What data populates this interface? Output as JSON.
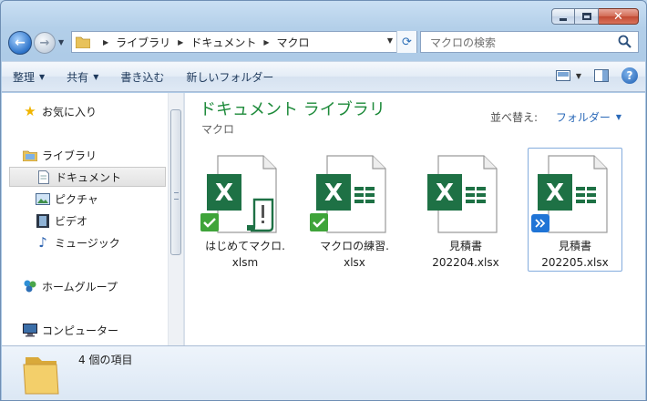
{
  "window": {
    "breadcrumb": [
      "ライブラリ",
      "ドキュメント",
      "マクロ"
    ],
    "search_placeholder": "マクロの検索"
  },
  "toolbar": {
    "organize": "整理",
    "share": "共有",
    "burn": "書き込む",
    "new_folder": "新しいフォルダー"
  },
  "sidebar": {
    "favorites": "お気に入り",
    "libraries": "ライブラリ",
    "documents": "ドキュメント",
    "pictures": "ピクチャ",
    "videos": "ビデオ",
    "music": "ミュージック",
    "homegroup": "ホームグループ",
    "computer": "コンピューター"
  },
  "main": {
    "library_title": "ドキュメント ライブラリ",
    "library_subtitle": "マクロ",
    "arrange_label": "並べ替え:",
    "arrange_value": "フォルダー",
    "files": [
      {
        "line1": "はじめてマクロ.",
        "line2": "xlsm",
        "overlay": "sync-ok",
        "type": "xlsm"
      },
      {
        "line1": "マクロの練習.",
        "line2": "xlsx",
        "overlay": "sync-ok",
        "type": "xlsx"
      },
      {
        "line1": "見積書",
        "line2": "202204.xlsx",
        "overlay": "none",
        "type": "xlsx"
      },
      {
        "line1": "見積書",
        "line2": "202205.xlsx",
        "overlay": "shortcut",
        "type": "xlsx"
      }
    ]
  },
  "status": {
    "item_count": "4 個の項目"
  },
  "colors": {
    "excel_green": "#1e7145",
    "library_title": "#1d8a3a",
    "link_blue": "#2a69b8"
  }
}
